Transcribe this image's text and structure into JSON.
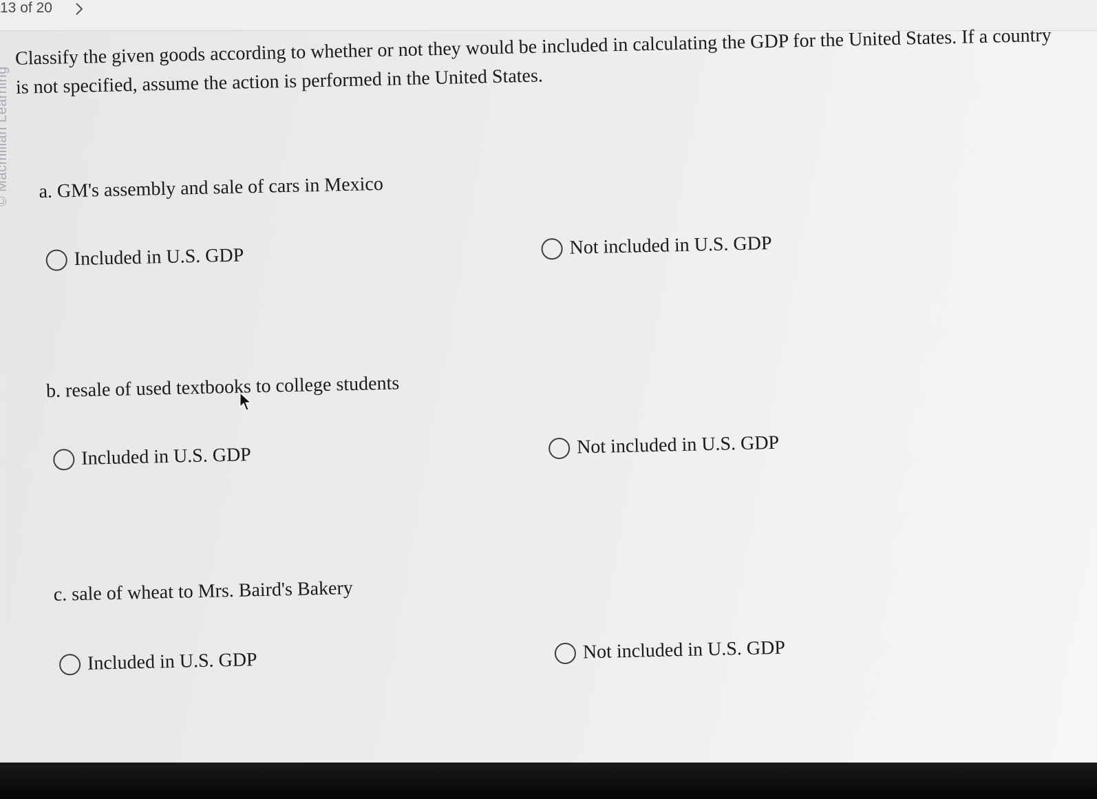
{
  "nav": {
    "counter": "13 of 20",
    "next_icon": "chevron-right-icon"
  },
  "watermark": "© Macmillan Learning",
  "question": {
    "prompt": "Classify the given goods according to whether or not they would be included in calculating the GDP for the United States. If a country is not specified, assume the action is performed in the United States.",
    "items": [
      {
        "letter": "a.",
        "text": "GM's assembly and sale of cars in Mexico",
        "options": [
          "Included in U.S. GDP",
          "Not included in U.S. GDP"
        ]
      },
      {
        "letter": "b.",
        "text": "resale of used textbooks to college students",
        "options": [
          "Included in U.S. GDP",
          "Not included in U.S. GDP"
        ]
      },
      {
        "letter": "c.",
        "text": "sale of wheat to Mrs. Baird's Bakery",
        "options": [
          "Included in U.S. GDP",
          "Not included in U.S. GDP"
        ]
      }
    ]
  }
}
